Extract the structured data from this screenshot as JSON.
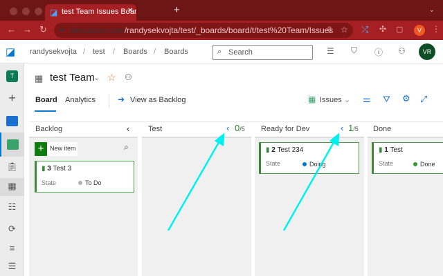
{
  "browser": {
    "tab_title": "test Team Issues Board - Boards",
    "url_domain": "dev.azure.com",
    "url_path": "/randysekvojta/test/_boards/board/t/test%20Team/Issues",
    "profile_initial": "V"
  },
  "header": {
    "breadcrumbs": [
      "randysekvojta",
      "test",
      "Boards",
      "Boards"
    ],
    "search_placeholder": "Search",
    "avatar_initials": "VR"
  },
  "rail": {
    "project_initial": "T"
  },
  "board": {
    "team_title": "test Team",
    "tabs": [
      "Board",
      "Analytics"
    ],
    "active_tab": "Board",
    "view_as_backlog": "View as Backlog",
    "work_item_type": "Issues"
  },
  "columns": [
    {
      "name": "Backlog",
      "new_item": "New item",
      "cards": [
        {
          "id": "3",
          "title": "Test 3",
          "state_label": "State",
          "state": "To Do",
          "state_color": "#b2b2b2"
        }
      ]
    },
    {
      "name": "Test",
      "wip_count": "0",
      "wip_limit": "/5",
      "cards": []
    },
    {
      "name": "Ready for Dev",
      "wip_count": "1",
      "wip_limit": "/5",
      "cards": [
        {
          "id": "2",
          "title": "Test 234",
          "state_label": "State",
          "state": "Doing",
          "state_color": "#0078d4"
        }
      ]
    },
    {
      "name": "Done",
      "cards": [
        {
          "id": "1",
          "title": "Test",
          "state_label": "State",
          "state": "Done",
          "state_color": "#339933"
        }
      ]
    }
  ],
  "colors": {
    "tabbar": "#6e1516",
    "addressbar": "#a61f22",
    "annotation_arrow": "#00f0f0"
  }
}
